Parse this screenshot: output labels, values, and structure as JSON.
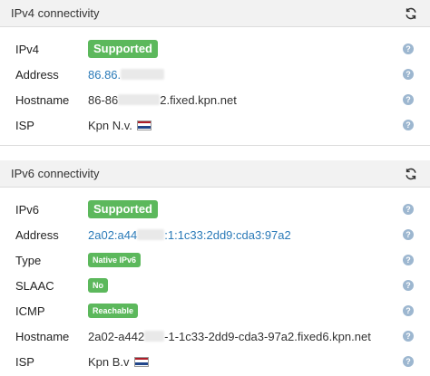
{
  "ipv4": {
    "title": "IPv4 connectivity",
    "rows": {
      "ipv4": {
        "label": "IPv4",
        "value": "Supported"
      },
      "address": {
        "label": "Address",
        "value": "86.86."
      },
      "hostname": {
        "label": "Hostname",
        "value_pre": "86-86",
        "value_post": "2.fixed.kpn.net"
      },
      "isp": {
        "label": "ISP",
        "value": "Kpn N.v."
      }
    }
  },
  "ipv6": {
    "title": "IPv6 connectivity",
    "rows": {
      "ipv6": {
        "label": "IPv6",
        "value": "Supported"
      },
      "address": {
        "label": "Address",
        "value_pre": "2a02:a44",
        "value_post": ":1:1c33:2dd9:cda3:97a2"
      },
      "type": {
        "label": "Type",
        "value": "Native IPv6"
      },
      "slaac": {
        "label": "SLAAC",
        "value": "No"
      },
      "icmp": {
        "label": "ICMP",
        "value": "Reachable"
      },
      "hostname": {
        "label": "Hostname",
        "value_pre": "2a02-a442",
        "value_post": "-1-1c33-2dd9-cda3-97a2.fixed6.kpn.net"
      },
      "isp": {
        "label": "ISP",
        "value": "Kpn B.v"
      }
    }
  },
  "help_glyph": "?",
  "icons": {
    "refresh": "refresh-icon",
    "help": "help-icon",
    "flag": "netherlands-flag-icon"
  },
  "colors": {
    "badge": "#5cb85c",
    "link": "#2a7ab8",
    "flag_red": "#ae1c28",
    "flag_white": "#ffffff",
    "flag_blue": "#21468b"
  }
}
